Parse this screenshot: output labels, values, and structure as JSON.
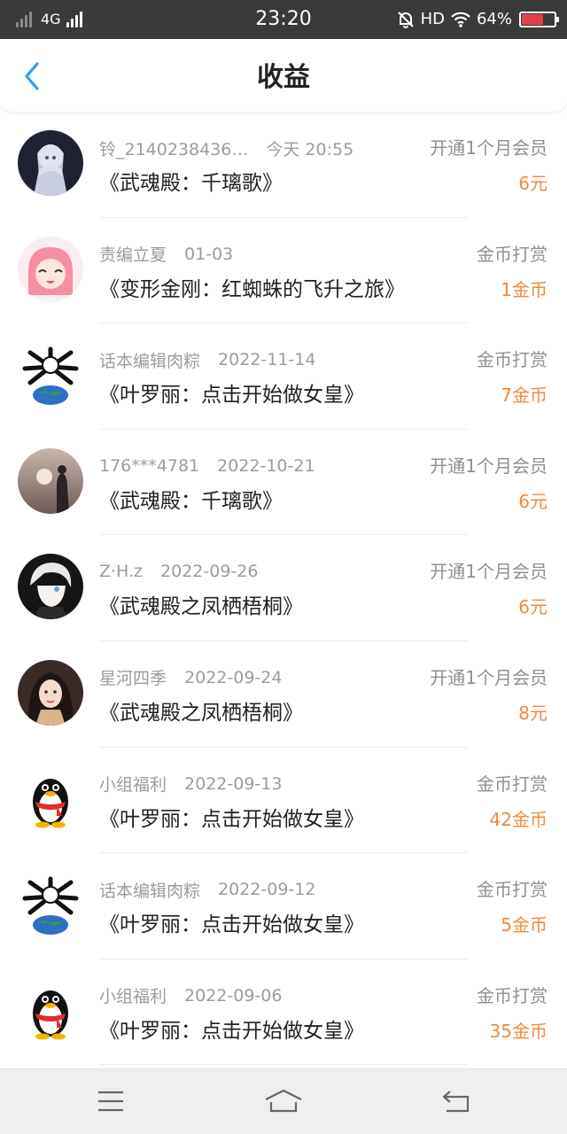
{
  "status_bar": {
    "network": "4G",
    "time": "23:20",
    "hd": "HD",
    "battery_percent": "64%",
    "battery_level": 0.64,
    "battery_color": "#e2414a",
    "icons": [
      "signal-icon",
      "mute-bell-icon",
      "wifi-icon",
      "battery-icon"
    ]
  },
  "header": {
    "title": "收益",
    "back_icon": "chevron-left-icon",
    "accent": "#2a9df4"
  },
  "colors": {
    "amount": "#f08a3c",
    "meta": "#9c9c9c",
    "title": "#222222"
  },
  "items": [
    {
      "user": "铃_2140238436…",
      "date": "今天 20:55",
      "book": "《武魂殿：千璃歌》",
      "type": "开通1个月会员",
      "amount": "6元",
      "avatar": "anime-girl-silver-avatar"
    },
    {
      "user": "责编立夏",
      "date": "01-03",
      "book": "《变形金刚：红蜘蛛的飞升之旅》",
      "type": "金币打赏",
      "amount": "1金币",
      "avatar": "pink-hair-girl-avatar"
    },
    {
      "user": "话本编辑肉粽",
      "date": "2022-11-14",
      "book": "《叶罗丽：点击开始做女皇》",
      "type": "金币打赏",
      "amount": "7金币",
      "avatar": "earth-bones-avatar"
    },
    {
      "user": "176***4781",
      "date": "2022-10-21",
      "book": "《武魂殿：千璃歌》",
      "type": "开通1个月会员",
      "amount": "6元",
      "avatar": "sunset-silhouette-avatar"
    },
    {
      "user": "Z·H.z",
      "date": "2022-09-26",
      "book": "《武魂殿之凤栖梧桐》",
      "type": "开通1个月会员",
      "amount": "6元",
      "avatar": "dark-anime-boy-avatar"
    },
    {
      "user": "星河四季",
      "date": "2022-09-24",
      "book": "《武魂殿之凤栖梧桐》",
      "type": "开通1个月会员",
      "amount": "8元",
      "avatar": "dark-hair-girl-avatar"
    },
    {
      "user": "小组福利",
      "date": "2022-09-13",
      "book": "《叶罗丽：点击开始做女皇》",
      "type": "金币打赏",
      "amount": "42金币",
      "avatar": "qq-penguin-avatar"
    },
    {
      "user": "话本编辑肉粽",
      "date": "2022-09-12",
      "book": "《叶罗丽：点击开始做女皇》",
      "type": "金币打赏",
      "amount": "5金币",
      "avatar": "earth-bones-avatar"
    },
    {
      "user": "小组福利",
      "date": "2022-09-06",
      "book": "《叶罗丽：点击开始做女皇》",
      "type": "金币打赏",
      "amount": "35金币",
      "avatar": "qq-penguin-avatar"
    }
  ],
  "bottom_nav": {
    "buttons": [
      "menu-icon",
      "home-icon",
      "back-icon"
    ]
  }
}
